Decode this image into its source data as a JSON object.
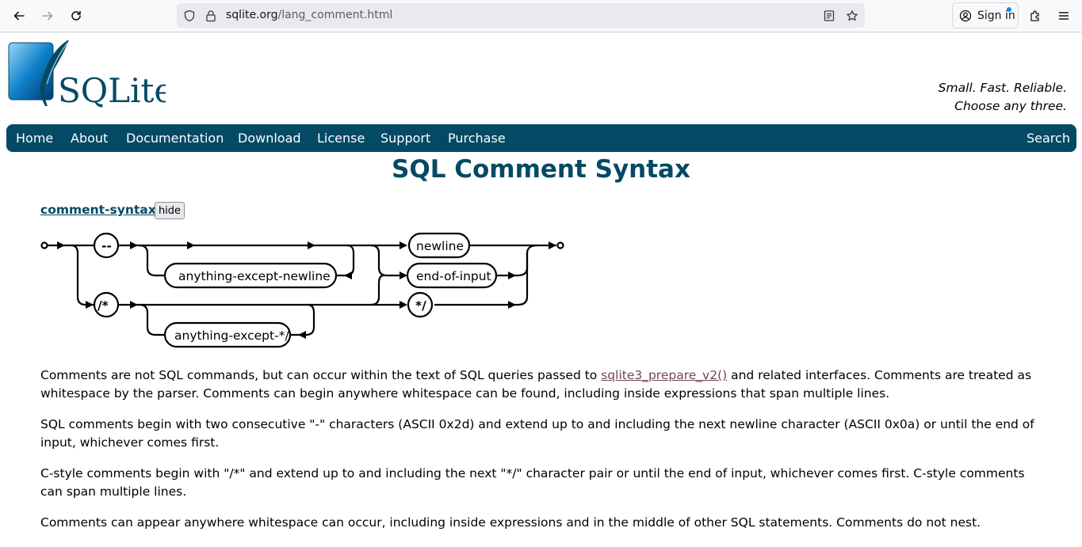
{
  "browser": {
    "url_domain": "sqlite.org",
    "url_path": "/lang_comment.html",
    "sign_in_label": "Sign in",
    "icons": [
      "back-icon",
      "forward-icon",
      "reload-icon",
      "shield-icon",
      "lock-icon",
      "reader-view-icon",
      "bookmark-star-icon",
      "account-icon",
      "extensions-icon",
      "menu-icon"
    ]
  },
  "header": {
    "logo_text": "SQLite",
    "tagline_line1": "Small. Fast. Reliable.",
    "tagline_line2": "Choose any three."
  },
  "menu": {
    "items": [
      "Home",
      "About",
      "Documentation",
      "Download",
      "License",
      "Support",
      "Purchase"
    ],
    "search_label": "Search"
  },
  "main": {
    "title": "SQL Comment Syntax",
    "syntax_link": "comment-syntax:",
    "hide_label": "hide",
    "diagram": {
      "dash_dash": "--",
      "anything_except_newline": "anything-except-newline",
      "newline": "newline",
      "end_of_input": "end-of-input",
      "slash_star": "/*",
      "star_slash": "*/",
      "anything_except_star_slash": "anything-except-*/"
    },
    "p1_before": "Comments are not SQL commands, but can occur within the text of SQL queries passed to ",
    "p1_link": "sqlite3_prepare_v2()",
    "p1_after": " and related interfaces. Comments are treated as whitespace by the parser. Comments can begin anywhere whitespace can be found, including inside expressions that span multiple lines.",
    "p2": "SQL comments begin with two consecutive \"-\" characters (ASCII 0x2d) and extend up to and including the next newline character (ASCII 0x0a) or until the end of input, whichever comes first.",
    "p3": "C-style comments begin with \"/*\" and extend up to and including the next \"*/\" character pair or until the end of input, whichever comes first. C-style comments can span multiple lines.",
    "p4": "Comments can appear anywhere whitespace can occur, including inside expressions and in the middle of other SQL statements. Comments do not nest."
  },
  "colors": {
    "brand": "#044a64",
    "link_visited": "#734559"
  }
}
